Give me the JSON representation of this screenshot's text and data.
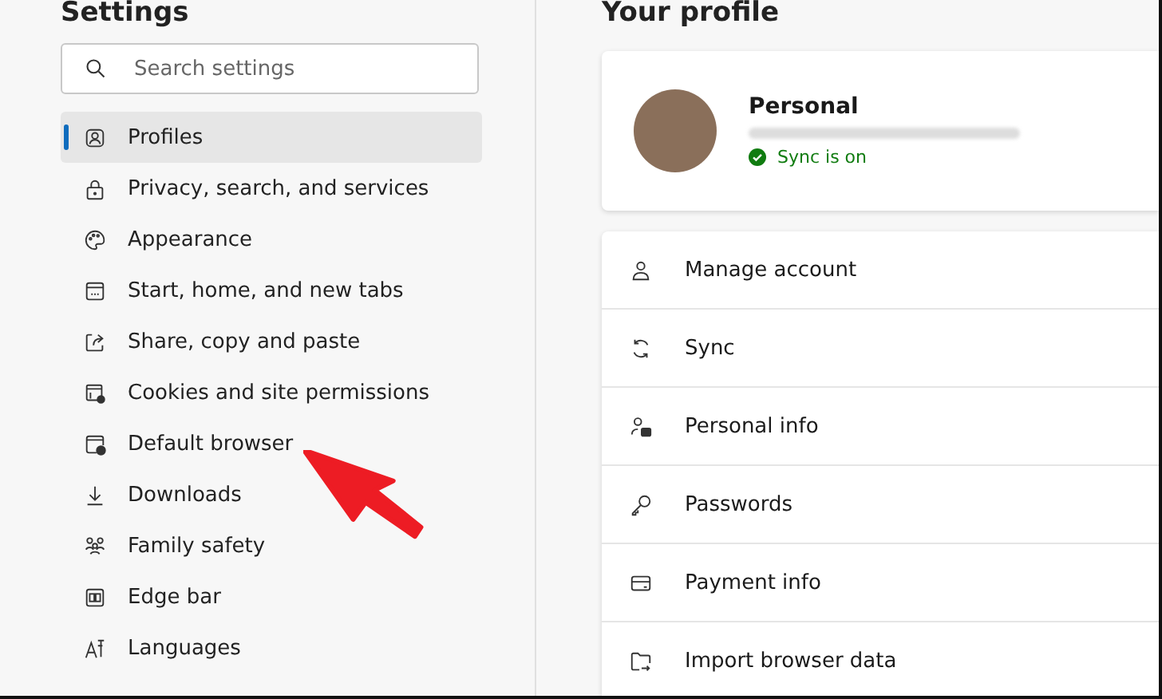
{
  "sidebar": {
    "title": "Settings",
    "search": {
      "placeholder": "Search settings"
    },
    "items": [
      {
        "label": "Profiles",
        "selected": true
      },
      {
        "label": "Privacy, search, and services",
        "selected": false
      },
      {
        "label": "Appearance",
        "selected": false
      },
      {
        "label": "Start, home, and new tabs",
        "selected": false
      },
      {
        "label": "Share, copy and paste",
        "selected": false
      },
      {
        "label": "Cookies and site permissions",
        "selected": false
      },
      {
        "label": "Default browser",
        "selected": false
      },
      {
        "label": "Downloads",
        "selected": false
      },
      {
        "label": "Family safety",
        "selected": false
      },
      {
        "label": "Edge bar",
        "selected": false
      },
      {
        "label": "Languages",
        "selected": false
      }
    ]
  },
  "main": {
    "title": "Your profile",
    "profile": {
      "name": "Personal",
      "sync_status": "Sync is on"
    },
    "rows": [
      {
        "label": "Manage account"
      },
      {
        "label": "Sync"
      },
      {
        "label": "Personal info"
      },
      {
        "label": "Passwords"
      },
      {
        "label": "Payment info"
      },
      {
        "label": "Import browser data"
      }
    ]
  }
}
